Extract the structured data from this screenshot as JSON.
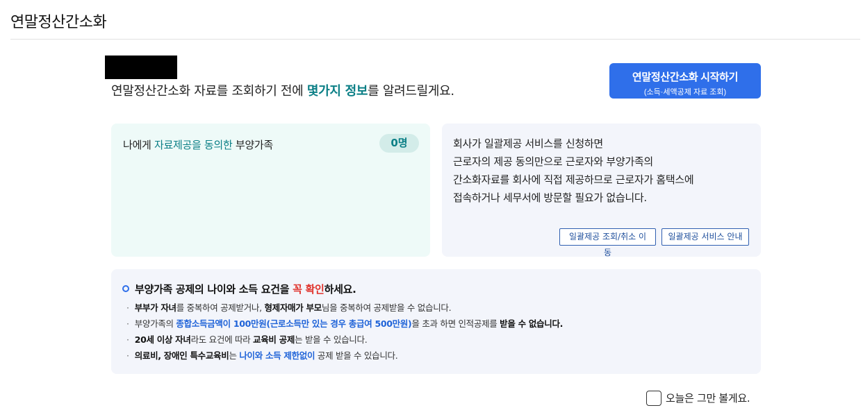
{
  "header": {
    "title": "연말정산간소화"
  },
  "intro": {
    "text_before": "연말정산간소화 자료를 조회하기 전에 ",
    "highlight": "몇가지 정보",
    "text_after": "를 알려드릴게요."
  },
  "start_button": {
    "line1": "연말정산간소화 시작하기",
    "line2": "(소득·세액공제 자료 조회)"
  },
  "dependents_card": {
    "prefix": "나에게 ",
    "highlight": "자료제공을 동의한",
    "suffix": " 부양가족",
    "count": "0명"
  },
  "bulk_card": {
    "lines": [
      "회사가 일괄제공 서비스를 신청하면",
      "근로자의 제공 동의만으로 근로자와 부양가족의",
      "간소화자료를 회사에 직접 제공하므로 근로자가 홈택스에",
      "접속하거나 세무서에 방문할 필요가 없습니다."
    ],
    "lookup_button": "일괄제공 조회/취소 이동",
    "guide_button": "일괄제공 서비스 안내"
  },
  "notice": {
    "head_before": "부양가족 공제의 나이와 소득 요건을 ",
    "head_red": "꼭 확인",
    "head_after": "하세요.",
    "items": {
      "i1": {
        "b1": "부부가 자녀",
        "t1": "를 중복하여 공제받거나, ",
        "b2": "형제자매가 부모",
        "t2": "님을 중복하여 공제받을 수 없습니다."
      },
      "i2": {
        "t1": "부양가족의 ",
        "blue": "종합소득금액이 100만원(근로소득만 있는 경우 총급여 500만원)",
        "t2": "을 초과 하면 인적공제를 ",
        "b": "받을 수 없습니다."
      },
      "i3": {
        "b1": "20세 이상 자녀",
        "t1": "라도 요건에 따라 ",
        "b2": "교육비 공제",
        "t2": "는 받을 수 있습니다."
      },
      "i4": {
        "b1": "의료비, 장애인 특수교육비",
        "t1": "는 ",
        "blue": "나이와 소득 제한없이",
        "t2": " 공제 받을 수 있습니다."
      }
    }
  },
  "footer": {
    "dont_show_label": "오늘은 그만 볼게요."
  },
  "colors": {
    "teal": "#0b7f86",
    "blue": "#2f6fea",
    "red": "#e0322b"
  }
}
